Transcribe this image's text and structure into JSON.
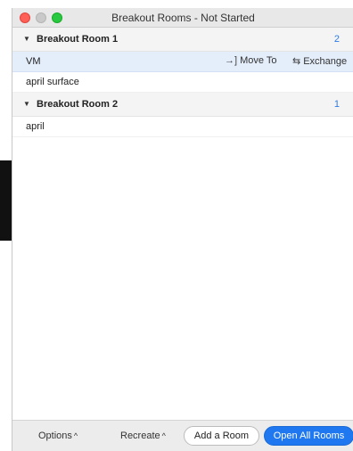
{
  "window": {
    "title": "Breakout Rooms - Not Started"
  },
  "rooms": [
    {
      "name": "Breakout Room 1",
      "count": "2",
      "participants": [
        {
          "name": "VM",
          "selected": true
        },
        {
          "name": "april surface",
          "selected": false
        }
      ]
    },
    {
      "name": "Breakout Room 2",
      "count": "1",
      "participants": [
        {
          "name": "april",
          "selected": false
        }
      ]
    }
  ],
  "row_actions": {
    "move_to_label": "Move To",
    "exchange_label": "Exchange",
    "move_icon": "move-to-icon",
    "exchange_icon": "exchange-icon"
  },
  "footer": {
    "options_label": "Options",
    "recreate_label": "Recreate",
    "add_room_label": "Add a Room",
    "open_all_label": "Open All Rooms"
  },
  "colors": {
    "accent": "#1f78ef",
    "count": "#2d7be5",
    "selected_row": "#e4eefb"
  }
}
